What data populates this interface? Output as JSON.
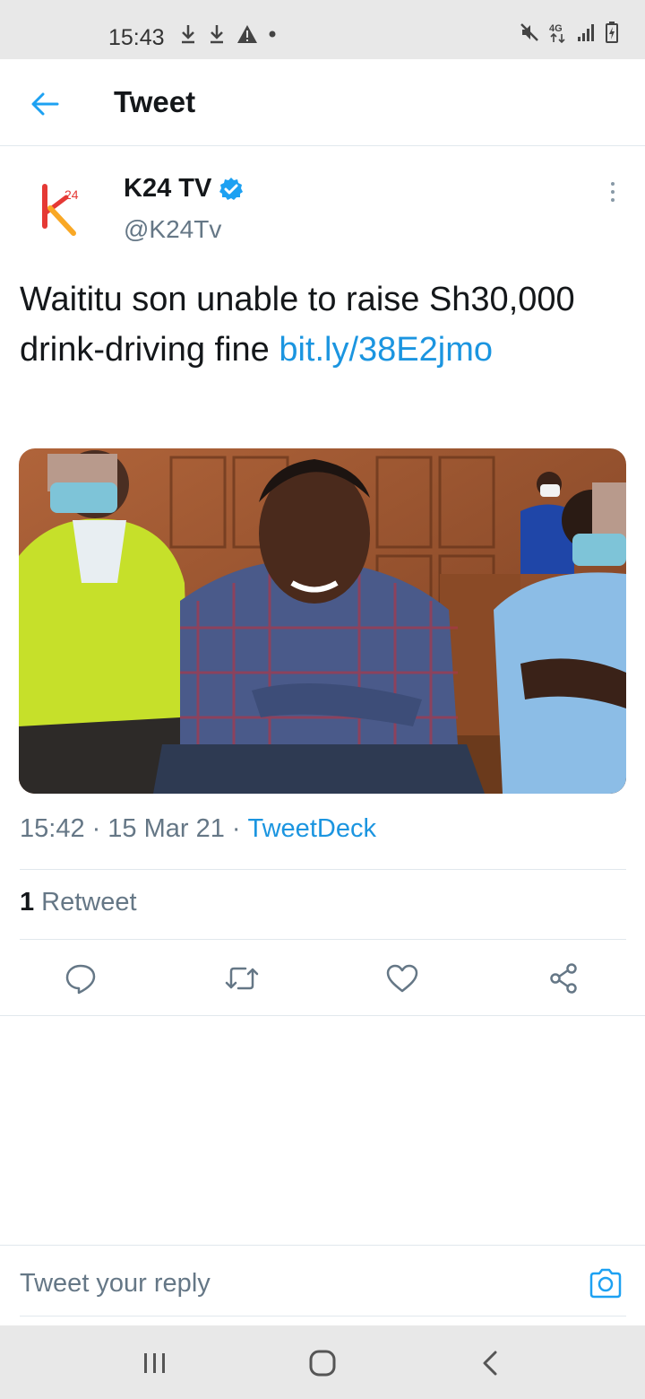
{
  "status_bar": {
    "time": "15:43",
    "left_icons": [
      "download-icon",
      "download-icon",
      "warning-icon",
      "dot-icon"
    ],
    "right_icons": [
      "mute-icon",
      "4g-icon",
      "signal-icon",
      "battery-icon"
    ],
    "network_label": "4G"
  },
  "header": {
    "title": "Tweet"
  },
  "tweet": {
    "author_name": "K24 TV",
    "author_handle": "@K24Tv",
    "verified": true,
    "avatar_text": "24",
    "text": "Waititu son unable to raise Sh30,000 drink-driving fine ",
    "link": "bit.ly/38E2jmo",
    "time": "15:42",
    "separator": "·",
    "date": "15 Mar 21",
    "source": "TweetDeck",
    "retweet_count": "1",
    "retweet_label": "Retweet"
  },
  "actions": [
    "reply-icon",
    "retweet-icon",
    "like-icon",
    "share-icon"
  ],
  "reply_bar": {
    "placeholder": "Tweet your reply"
  },
  "nav_bar": [
    "recent-apps-icon",
    "home-icon",
    "back-icon"
  ],
  "colors": {
    "accent": "#1b95e0",
    "secondary_text": "#657786",
    "primary_text": "#14171a",
    "divider": "#e1e8ed",
    "system_bar": "#e8e8e8"
  }
}
